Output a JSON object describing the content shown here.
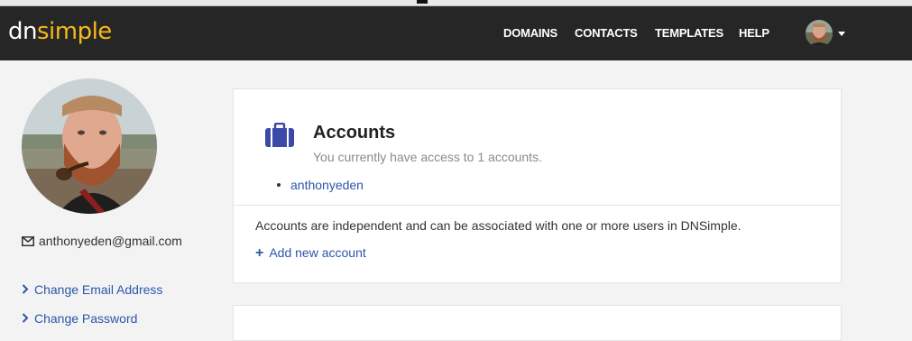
{
  "brand": {
    "part1": "dn",
    "part2": "simple"
  },
  "nav": {
    "links": [
      "DOMAINS",
      "CONTACTS",
      "TEMPLATES",
      "HELP"
    ]
  },
  "sidebar": {
    "email": "anthonyeden@gmail.com",
    "links": [
      "Change Email Address",
      "Change Password"
    ]
  },
  "accounts_card": {
    "title": "Accounts",
    "subtitle": "You currently have access to 1 accounts.",
    "accounts": [
      "anthonyeden"
    ],
    "description": "Accounts are independent and can be associated with one or more users in DNSimple.",
    "add_label": "Add new account"
  },
  "colors": {
    "navbar": "#262626",
    "brand_accent": "#f5b91b",
    "link": "#2d56a8",
    "briefcase": "#3b4aa8"
  },
  "icons": [
    "envelope-icon",
    "chevron-right-icon",
    "briefcase-icon",
    "plus-icon",
    "caret-down-icon"
  ]
}
